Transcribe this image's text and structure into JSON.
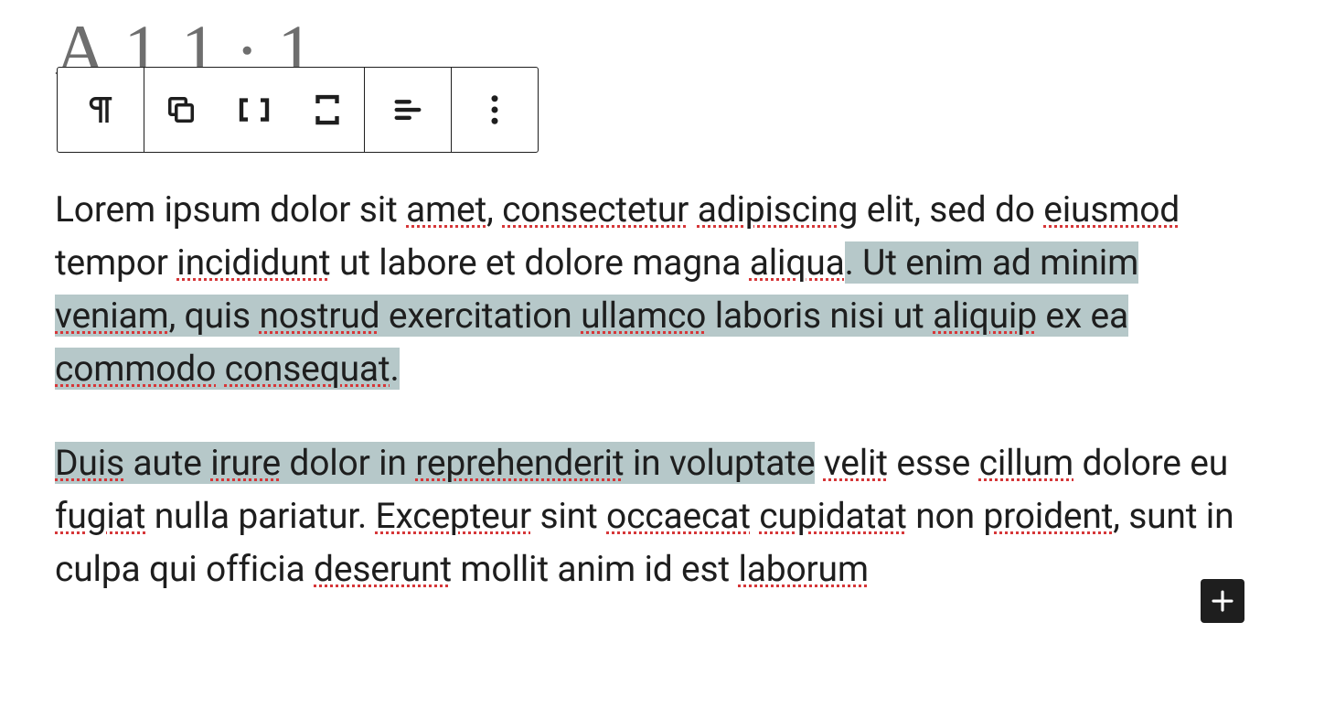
{
  "title_peek": "A 1 1 ∙ 1",
  "toolbar": {
    "paragraph_icon": "paragraph",
    "drag_icon": "drag",
    "move_up_icon": "move-up",
    "move_down_icon": "move-down",
    "align_icon": "align-left",
    "more_icon": "more"
  },
  "content": {
    "p1": {
      "s1": "Lorem ipsum dolor sit ",
      "w_amet": "amet",
      "s2": ", ",
      "w_consectetur": "consectetur",
      "s3": " ",
      "w_adipiscing": "adipiscing",
      "s4": " elit, sed do ",
      "w_eiusmod": "eiusmod",
      "s5": " tempor ",
      "w_incididunt": "incididunt",
      "s6": " ut labore et dolore magna ",
      "w_aliqua": "aliqua",
      "s7_sel": ". Ut enim ad minim ",
      "w_veniam": "veniam",
      "s8_sel": ", quis ",
      "w_nostrud": "nostrud",
      "s9_sel": " exercitation ",
      "w_ullamco": "ullamco",
      "s10_sel": " laboris nisi ut ",
      "w_aliquip": "aliquip",
      "s11_sel": " ex ea ",
      "w_commodo": "commodo",
      "s12_sel": " ",
      "w_consequat": "consequat",
      "s13_sel": "."
    },
    "p2": {
      "w_duis": "Duis",
      "s1_sel": " aute ",
      "w_irure": "irure",
      "s2_sel": " dolor in ",
      "w_reprehenderit": "reprehenderit",
      "s3_sel": " in ",
      "s3b_sel": "voluptate",
      "s4": " ",
      "w_velit": "velit",
      "s5": " esse ",
      "w_cillum": "cillum",
      "s6": " dolore eu ",
      "w_fugiat": "fugiat",
      "s7": " nulla pariatur. ",
      "w_excepteur": "Excepteur",
      "s8": " sint ",
      "w_occaecat": "occaecat",
      "s9": " ",
      "w_cupidatat": "cupidatat",
      "s10": " non ",
      "w_proident": "proident",
      "s11": ", sunt in culpa qui officia ",
      "w_deserunt": "deserunt",
      "s12": " mollit anim id est ",
      "w_laborum": "laborum"
    }
  },
  "add_button": "+"
}
